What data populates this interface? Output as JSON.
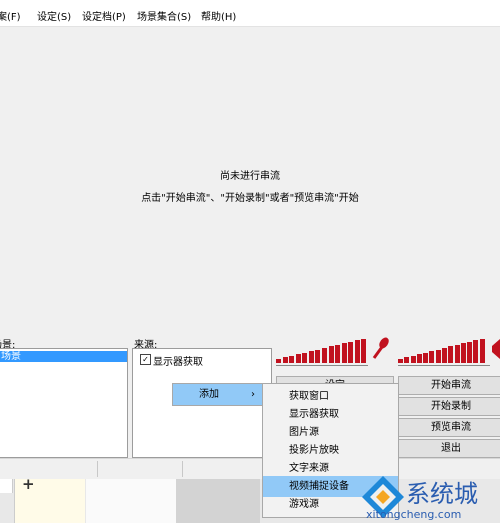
{
  "menubar": {
    "items": [
      "档案(F)",
      "设定(S)",
      "设定档(P)",
      "场景集合(S)",
      "帮助(H)"
    ]
  },
  "preview": {
    "line1": "尚未进行串流",
    "line2": "点击\"开始串流\"、\"开始录制\"或者\"预览串流\"开始"
  },
  "scenes": {
    "label": "场景:",
    "selected": "场景"
  },
  "sources": {
    "label": "来源:",
    "items": [
      "显示器获取"
    ]
  },
  "buttons": [
    "开始串流",
    "开始录制",
    "预览串流",
    "退出"
  ],
  "settings_button": "设定",
  "context_menu": {
    "add_label": "添加",
    "arrow": "›"
  },
  "submenu": {
    "items": [
      "获取窗口",
      "显示器获取",
      "图片源",
      "投影片放映",
      "文字来源",
      "视频捕捉设备",
      "游戏源"
    ],
    "highlighted": 5
  },
  "plus": "+",
  "watermark": {
    "brand": "系统城",
    "url": "xitongcheng.com"
  },
  "colors": {
    "meter": "#c1121f",
    "highlight": "#91c9f7",
    "selection": "#3399ff"
  }
}
